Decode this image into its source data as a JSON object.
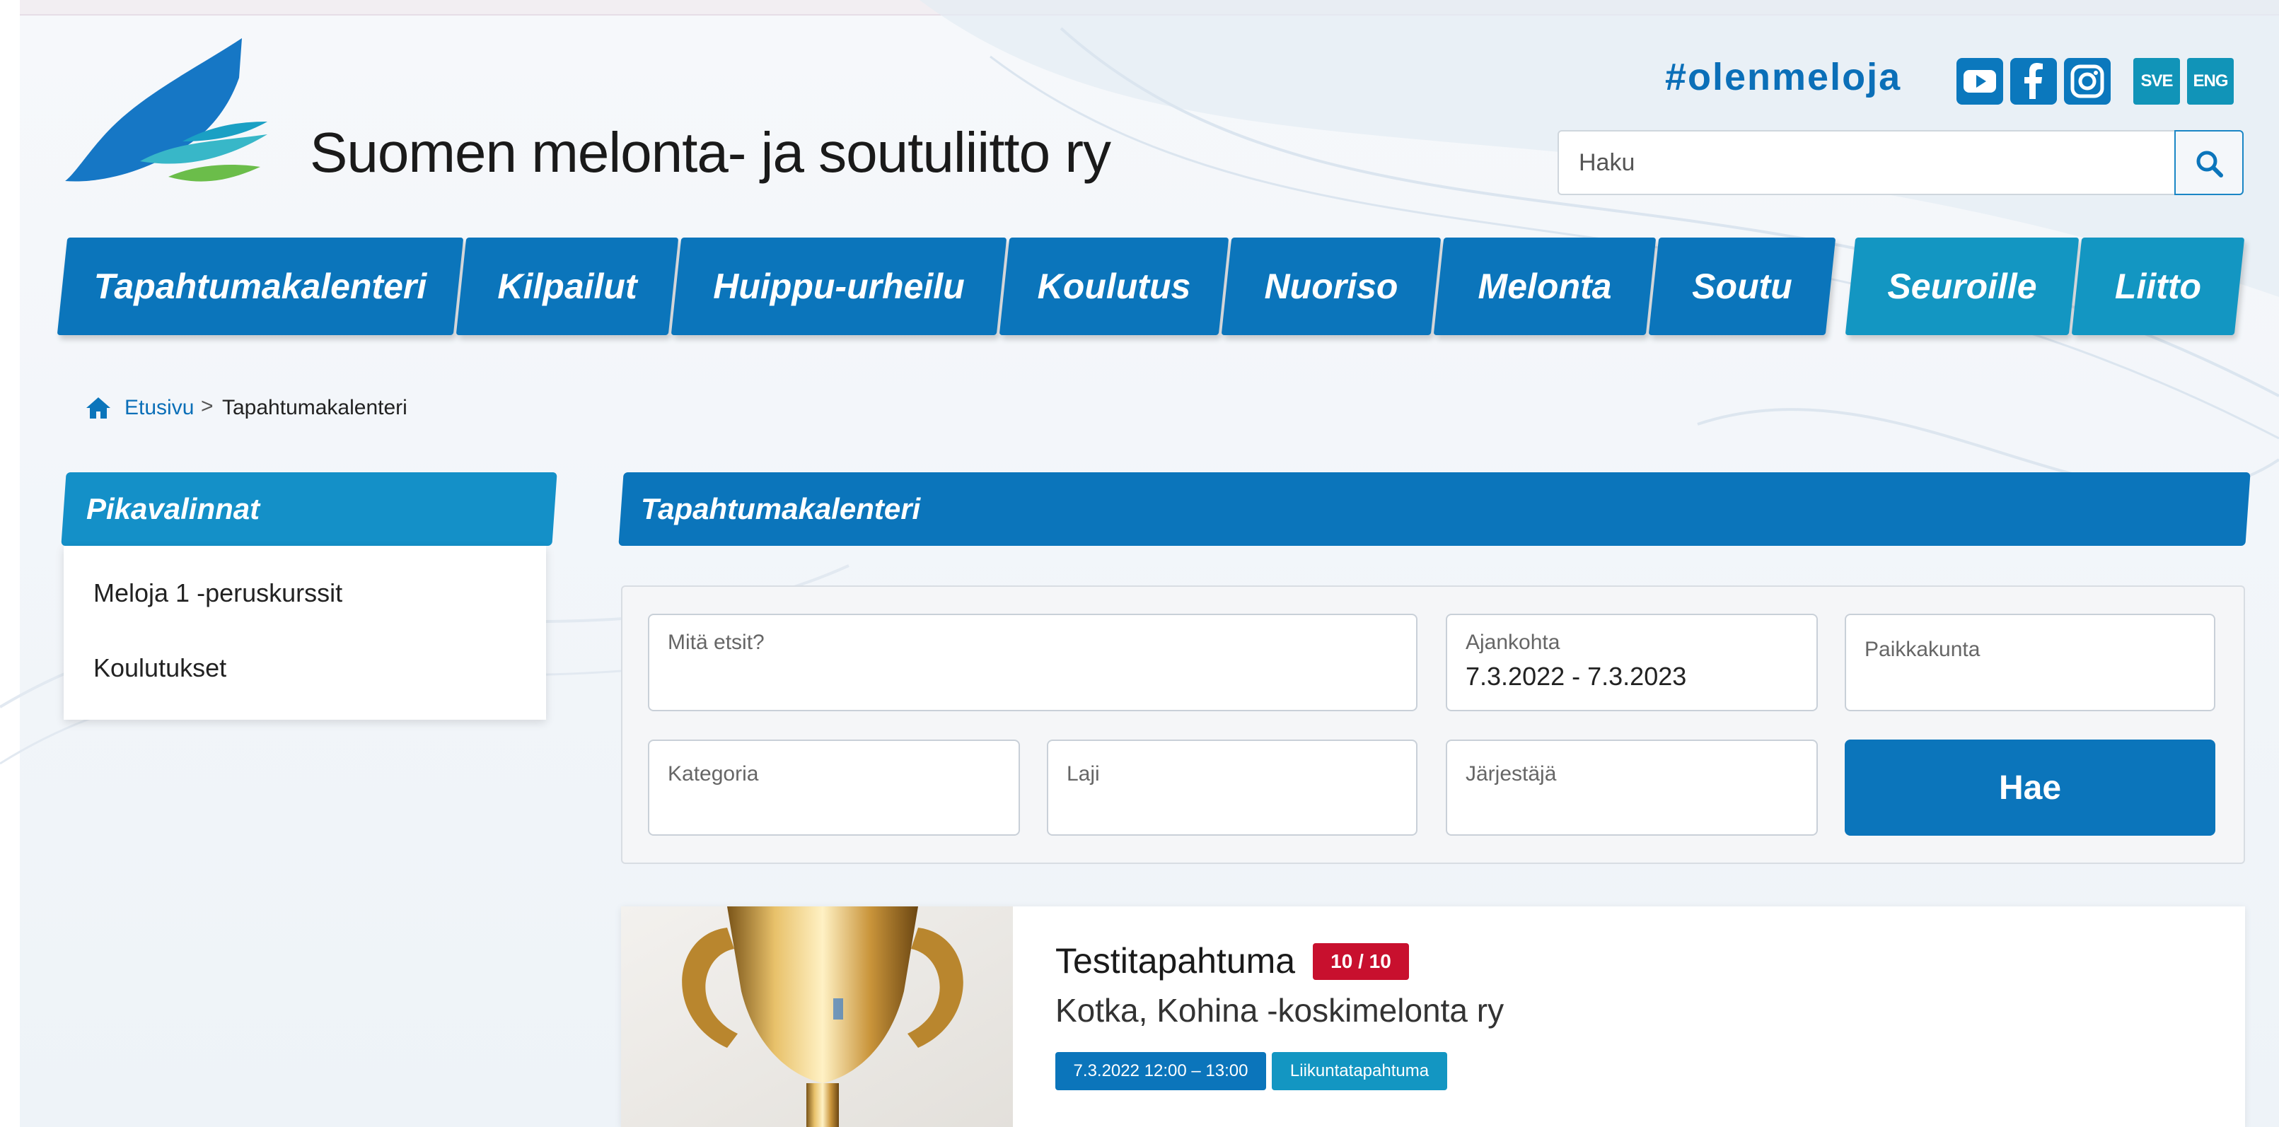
{
  "header": {
    "site_title": "Suomen melonta- ja soutuliitto ry",
    "hashtag": "#olenmeloja",
    "social": [
      "youtube-icon",
      "facebook-icon",
      "instagram-icon"
    ],
    "languages": [
      "SVE",
      "ENG"
    ],
    "search_placeholder": "Haku"
  },
  "nav": {
    "items": [
      {
        "label": "Tapahtumakalenteri"
      },
      {
        "label": "Kilpailut"
      },
      {
        "label": "Huippu-urheilu"
      },
      {
        "label": "Koulutus"
      },
      {
        "label": "Nuoriso"
      },
      {
        "label": "Melonta"
      },
      {
        "label": "Soutu"
      },
      {
        "label": "Seuroille"
      },
      {
        "label": "Liitto"
      }
    ]
  },
  "breadcrumb": {
    "home": "Etusivu",
    "separator": ">",
    "current": "Tapahtumakalenteri"
  },
  "sidebar": {
    "title": "Pikavalinnat",
    "links": [
      "Meloja 1 -peruskurssit",
      "Koulutukset"
    ]
  },
  "main": {
    "title": "Tapahtumakalenteri",
    "filters": {
      "search_label": "Mitä etsit?",
      "date_label": "Ajankohta",
      "date_value": "7.3.2022 - 7.3.2023",
      "location_label": "Paikkakunta",
      "category_label": "Kategoria",
      "sport_label": "Laji",
      "organizer_label": "Järjestäjä",
      "submit_label": "Hae"
    },
    "event": {
      "title": "Testitapahtuma",
      "badge": "10 / 10",
      "organizer": "Kotka, Kohina -koskimelonta ry",
      "datetime": "7.3.2022 12:00 – 13:00",
      "category": "Liikuntatapahtuma"
    }
  },
  "colors": {
    "primary_blue": "#0b75bb",
    "secondary_blue": "#1396c2",
    "badge_red": "#c8102e"
  }
}
